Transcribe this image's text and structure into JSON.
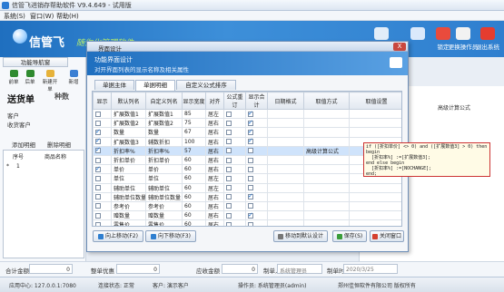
{
  "app": {
    "title": "信管飞进销存帮助软件 V9.4.649 - 试用版",
    "menu": [
      "系统(S)",
      "窗口(W)",
      "帮助(H)"
    ],
    "brand": "信管飞",
    "brand_sub": "随你化管理软件",
    "top_tools": [
      "",
      "",
      "",
      "",
      "锁定",
      "更换操作员",
      "退出系统"
    ]
  },
  "left": {
    "func_tab": "功能导航窗",
    "tools": [
      "前单",
      "后单",
      "新建开单",
      "新增"
    ],
    "doc_title": "送货单",
    "doc_title2": "种数",
    "labels": [
      "客户",
      "收货客户"
    ],
    "row_buttons": [
      "添加明细",
      "删除明细"
    ],
    "grid_headers": [
      "序号",
      "商品名称"
    ],
    "grid_row1": [
      "*",
      "1"
    ]
  },
  "dialog": {
    "title": "界面设计",
    "close": "X",
    "head_title": "功能界面设计",
    "head_sub": "对开界面列表的显示名称及相关属性",
    "tabs": [
      "单据主体",
      "单据明细",
      "自定义公式排序"
    ],
    "columns": [
      "显示",
      "默认列名",
      "自定义列名",
      "显示宽度",
      "对齐",
      "公式重订",
      "显示合计",
      "日期格式",
      "取值方式",
      "取值设置"
    ],
    "rows": [
      {
        "show": false,
        "name": "扩展数值1",
        "custom": "扩展数值1",
        "width": "85",
        "align": "居左",
        "formula": false,
        "total": true,
        "date": "",
        "mode": "",
        "set": ""
      },
      {
        "show": false,
        "name": "扩展数值2",
        "custom": "扩展数值2",
        "width": "75",
        "align": "居右",
        "formula": false,
        "total": true,
        "date": "",
        "mode": "",
        "set": ""
      },
      {
        "show": true,
        "name": "数量",
        "custom": "数量",
        "width": "67",
        "align": "居右",
        "formula": false,
        "total": true,
        "date": "",
        "mode": "",
        "set": ""
      },
      {
        "show": true,
        "name": "扩展数值3",
        "custom": "辅数折扣",
        "width": "100",
        "align": "居右",
        "formula": false,
        "total": true,
        "date": "",
        "mode": "",
        "set": ""
      },
      {
        "show": true,
        "name": "折扣率%",
        "custom": "折扣率%",
        "width": "57",
        "align": "居右",
        "formula": false,
        "total": false,
        "date": "",
        "mode": "高级计算公式",
        "set": ""
      },
      {
        "show": false,
        "name": "折扣单价",
        "custom": "折扣单价",
        "width": "60",
        "align": "居右",
        "formula": false,
        "total": false,
        "date": "",
        "mode": "",
        "set": ""
      },
      {
        "show": true,
        "name": "单价",
        "custom": "单价",
        "width": "60",
        "align": "居右",
        "formula": false,
        "total": false,
        "date": "",
        "mode": "",
        "set": ""
      },
      {
        "show": false,
        "name": "单位",
        "custom": "单位",
        "width": "60",
        "align": "居左",
        "formula": false,
        "total": false,
        "date": "",
        "mode": "",
        "set": ""
      },
      {
        "show": false,
        "name": "辅助单位",
        "custom": "辅助单位",
        "width": "60",
        "align": "居左",
        "formula": false,
        "total": false,
        "date": "",
        "mode": "",
        "set": ""
      },
      {
        "show": false,
        "name": "辅助单位数量",
        "custom": "辅助单位数量",
        "width": "60",
        "align": "居右",
        "formula": false,
        "total": true,
        "date": "",
        "mode": "",
        "set": ""
      },
      {
        "show": false,
        "name": "参考价",
        "custom": "参考价",
        "width": "60",
        "align": "居右",
        "formula": false,
        "total": false,
        "date": "",
        "mode": "",
        "set": ""
      },
      {
        "show": false,
        "name": "赠数量",
        "custom": "赠数量",
        "width": "60",
        "align": "居右",
        "formula": false,
        "total": true,
        "date": "",
        "mode": "",
        "set": ""
      },
      {
        "show": false,
        "name": "零售价",
        "custom": "零售价",
        "width": "60",
        "align": "居右",
        "formula": false,
        "total": false,
        "date": "",
        "mode": "",
        "set": ""
      },
      {
        "show": false,
        "name": "金额",
        "custom": "金额",
        "width": "60",
        "align": "居右",
        "formula": false,
        "total": true,
        "date": "",
        "mode": "",
        "set": ""
      }
    ],
    "buttons": {
      "up": "向上移动(F2)",
      "down": "向下移动(F3)",
      "default": "移动到默认设计",
      "save": "保存(S)",
      "close": "关闭窗口"
    },
    "tooltip": "if ([折扣单价] <> 0) and ([扩展数值3] > 0) then\nbegin\n  [折扣率%] :=[扩展数值3];\nend else begin\n  [折扣率%] :=[NOCHANGE];\nend;",
    "formula_label_right": "高级计算公式"
  },
  "summary": {
    "labels": [
      "合计金额",
      "整单优惠",
      "应收金额",
      "制单人",
      "制单时间"
    ],
    "values": [
      "0",
      "0",
      "0",
      "系统管理员",
      "2020/3/25"
    ]
  },
  "status": [
    "应用中心: 127.0.0.1:7080",
    "连接状态: 正常",
    "客户: 演示客户",
    "操作员: 系统管理员(admin)",
    "郑州佳恒软件有限公司 版权所有"
  ]
}
